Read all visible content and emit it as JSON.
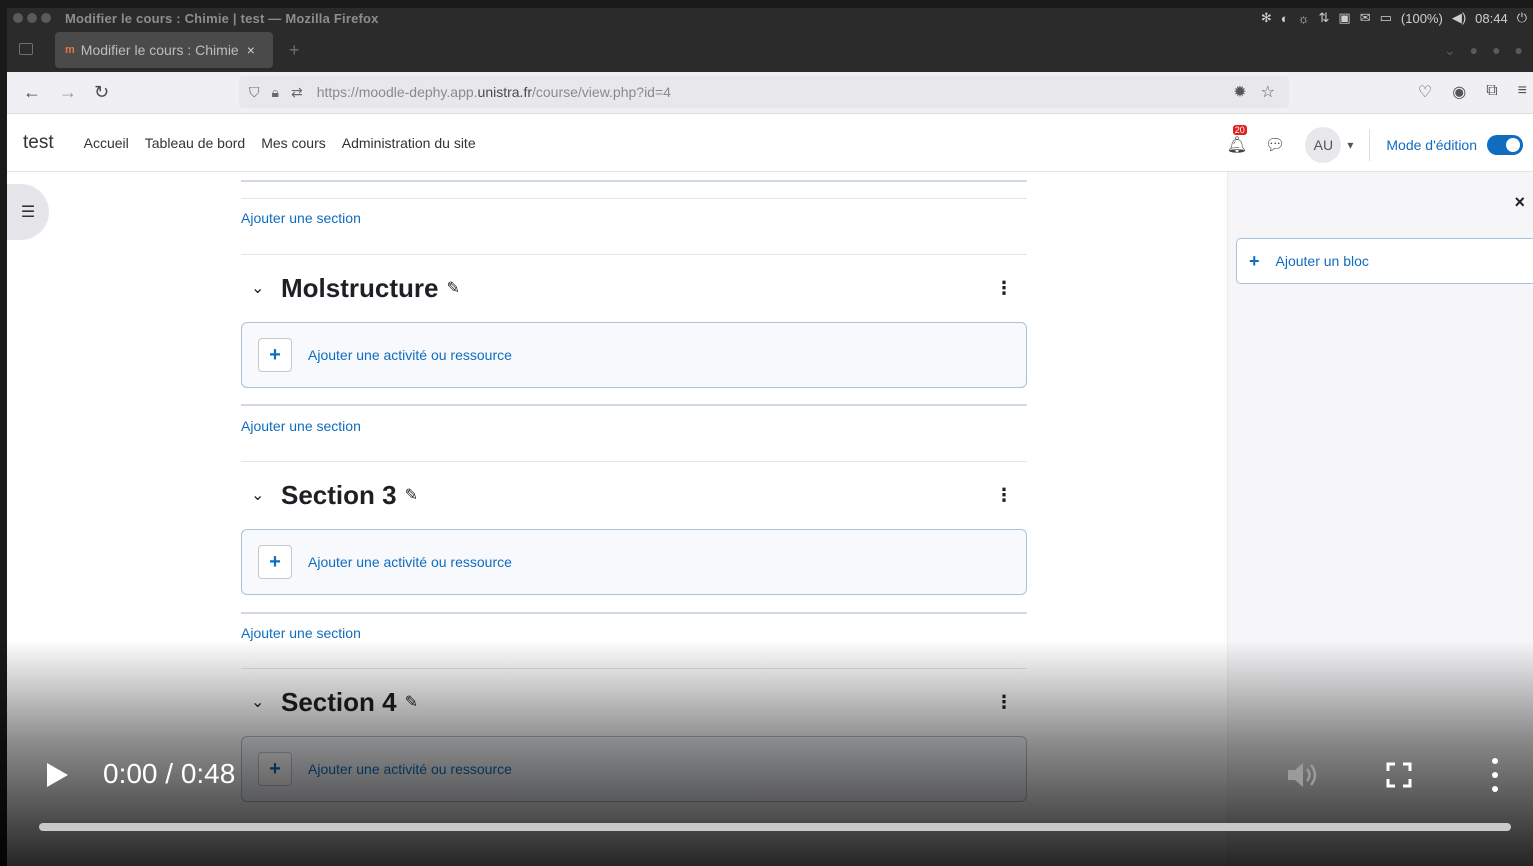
{
  "os": {
    "window_title": "Modifier le cours : Chimie | test — Mozilla Firefox",
    "battery": "(100%)",
    "clock": "08:44"
  },
  "browser": {
    "tab_title": "Modifier le cours : Chimie | test",
    "tab_favicon_text": "m",
    "url_host_prefix": "https://moodle-dephy.app.",
    "url_host_main": "unistra.fr",
    "url_path": "/course/view.php?id=4"
  },
  "header": {
    "site_name": "test",
    "nav": [
      "Accueil",
      "Tableau de bord",
      "Mes cours",
      "Administration du site"
    ],
    "notification_count": "20",
    "avatar_initials": "AU",
    "edit_mode_label": "Mode d'édition",
    "edit_mode_on": true
  },
  "course": {
    "add_section_label": "Ajouter une section",
    "add_activity_label": "Ajouter une activité ou ressource",
    "sections": [
      {
        "title": "Molstructure"
      },
      {
        "title": "Section 3"
      },
      {
        "title": "Section 4"
      }
    ]
  },
  "block_drawer": {
    "add_block_label": "Ajouter un bloc"
  },
  "video": {
    "time": "0:00 / 0:48",
    "progress_fraction": 0.0
  },
  "colors": {
    "accent": "#0f6cbf",
    "toggle_on": "#0f6cbf"
  }
}
